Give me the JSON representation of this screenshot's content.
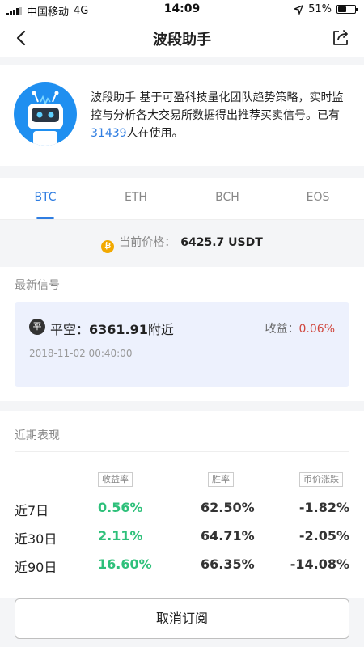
{
  "status_bar": {
    "carrier": "中国移动",
    "network": "4G",
    "time": "14:09",
    "battery": "51%",
    "battery_level": 0.51
  },
  "nav": {
    "title": "波段助手"
  },
  "intro": {
    "text_before": "波段助手 基于可盈科技量化团队趋势策略，实时监控与分析各大交易所数据得出推荐买卖信号。已有",
    "users": "31439",
    "text_after": "人在使用。"
  },
  "tabs": [
    {
      "label": "BTC",
      "active": true
    },
    {
      "label": "ETH",
      "active": false
    },
    {
      "label": "BCH",
      "active": false
    },
    {
      "label": "EOS",
      "active": false
    }
  ],
  "price": {
    "label": "当前价格：",
    "value": "6425.7 USDT",
    "coin_glyph": "₿"
  },
  "latest_signal": {
    "section_title": "最新信号",
    "badge": "平",
    "action": "平空：",
    "price": "6361.91",
    "suffix": "附近",
    "profit_label": "收益：",
    "profit_value": "0.06%",
    "time": "2018-11-02 00:40:00"
  },
  "performance": {
    "section_title": "近期表现",
    "headers": [
      "收益率",
      "胜率",
      "币价涨跌"
    ],
    "rows": [
      {
        "period": "近7日",
        "return": "0.56%",
        "win_rate": "62.50%",
        "price_change": "-1.82%"
      },
      {
        "period": "近30日",
        "return": "2.11%",
        "win_rate": "64.71%",
        "price_change": "-2.05%"
      },
      {
        "period": "近90日",
        "return": "16.60%",
        "win_rate": "66.35%",
        "price_change": "-14.08%"
      }
    ]
  },
  "actions": {
    "unsubscribe": "取消订阅"
  },
  "colors": {
    "accent": "#2f7de1",
    "positive": "#2ec07a",
    "profit": "#d0473e",
    "avatar_bg": "#1f8ff0"
  }
}
